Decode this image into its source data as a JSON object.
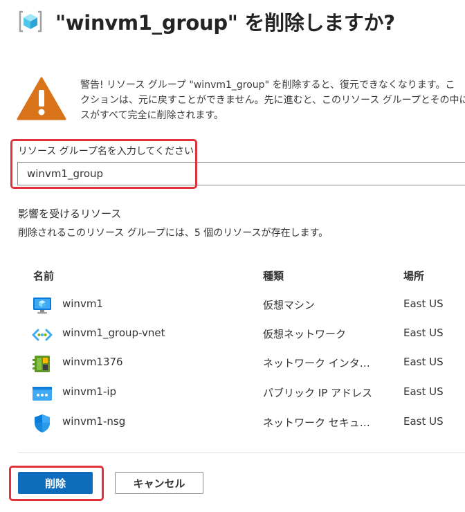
{
  "dialog": {
    "title": "\"winvm1_group\" を削除しますか?",
    "warning_text": "警告! リソース グループ \"winvm1_group\" を削除すると、復元できなくなります。こ\nクションは、元に戻すことができません。先に進むと、このリソース グループとその中に\nスがすべて完全に削除されます。",
    "confirm_label": "リソース グループ名を入力してください:",
    "confirm_value": "winvm1_group"
  },
  "affected": {
    "title": "影響を受けるリソース",
    "description": "削除されるこのリソース グループには、5 個のリソースが存在します。"
  },
  "table": {
    "headers": {
      "name": "名前",
      "type": "種類",
      "location": "場所"
    },
    "rows": [
      {
        "name": "winvm1",
        "type": "仮想マシン",
        "location": "East US",
        "icon": "virtual-machine-icon"
      },
      {
        "name": "winvm1_group-vnet",
        "type": "仮想ネットワーク",
        "location": "East US",
        "icon": "virtual-network-icon"
      },
      {
        "name": "winvm1376",
        "type": "ネットワーク インターフェ...",
        "location": "East US",
        "icon": "network-interface-icon"
      },
      {
        "name": "winvm1-ip",
        "type": "パブリック IP アドレス",
        "location": "East US",
        "icon": "public-ip-icon"
      },
      {
        "name": "winvm1-nsg",
        "type": "ネットワーク セキュリテ...",
        "location": "East US",
        "icon": "network-security-group-icon"
      }
    ]
  },
  "buttons": {
    "delete": "削除",
    "cancel": "キャンセル"
  },
  "colors": {
    "primary": "#0f6cbd",
    "warning": "#d9731a",
    "highlight": "#e0323b"
  }
}
